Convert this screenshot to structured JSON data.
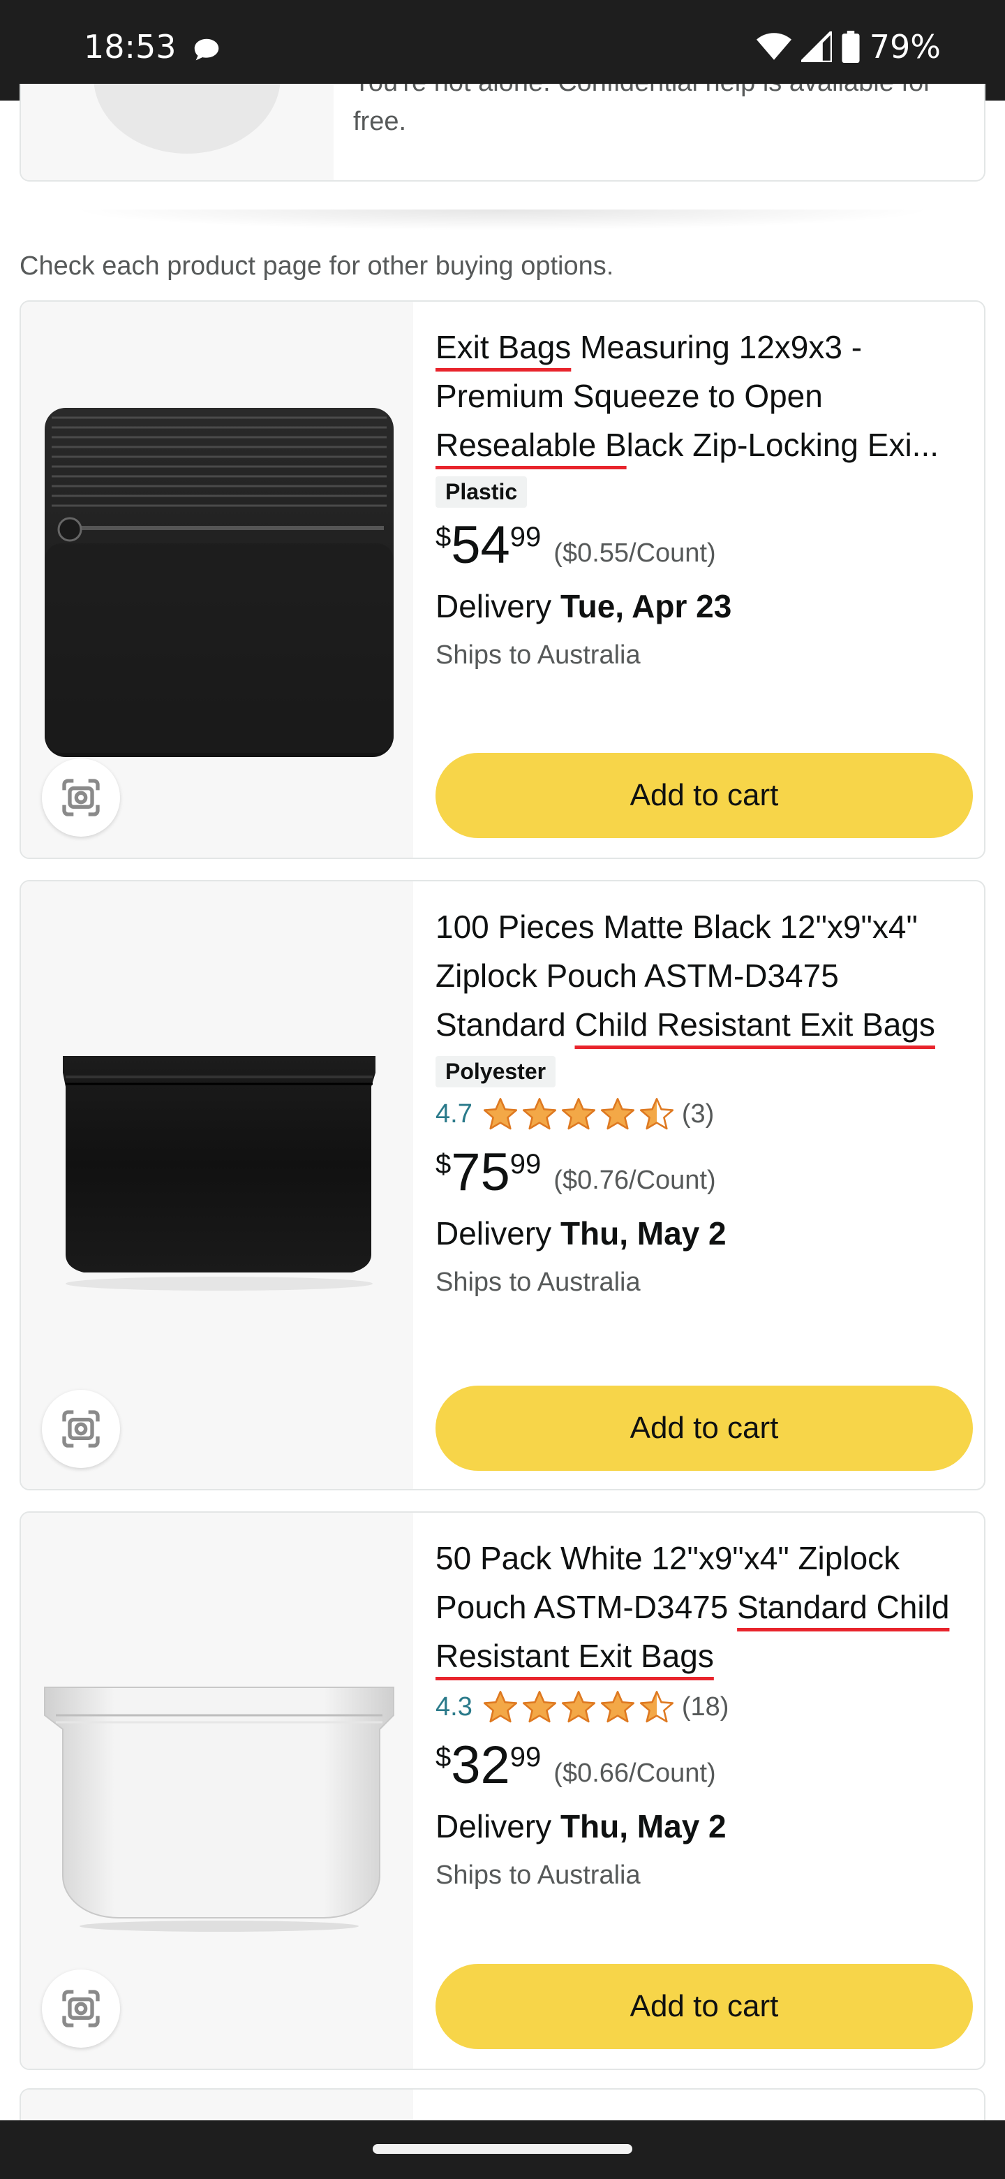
{
  "status_bar": {
    "time": "18:53",
    "battery": "79%"
  },
  "helpline": {
    "text": "You're not alone. Confidential help is available for free."
  },
  "options_note": "Check each product page for other buying options.",
  "colors": {
    "cart_button": "#f7d549",
    "rating": "#2a7a8a",
    "star": "#f3a847",
    "underline": "#e8242c"
  },
  "products": [
    {
      "title_parts": [
        "Exit Bags",
        " Measuring 12x9x3 - Premium Squeeze to Open ",
        "Resealable B",
        "lack Zip-Locking Exi..."
      ],
      "material": "Plastic",
      "price_currency": "$",
      "price_whole": "54",
      "price_fraction": "99",
      "unit_price": "($0.55/Count)",
      "delivery_label": "Delivery",
      "delivery_date": "Tue, Apr 23",
      "ships": "Ships to Australia",
      "cart_label": "Add to cart",
      "image": "black-zip-bag-stack"
    },
    {
      "title_parts": [
        "100 Pieces Matte Black 12\"x9\"x4\" Ziplock Pouch ASTM-D3475 Standard ",
        "Child Resistant Exit Bags"
      ],
      "material": "Polyester",
      "rating": "4.7",
      "stars": 4.5,
      "rating_count": "(3)",
      "price_currency": "$",
      "price_whole": "75",
      "price_fraction": "99",
      "unit_price": "($0.76/Count)",
      "delivery_label": "Delivery",
      "delivery_date": "Thu, May 2",
      "ships": "Ships to Australia",
      "cart_label": "Add to cart",
      "image": "matte-black-pouch"
    },
    {
      "title_parts": [
        "50 Pack White 12\"x9\"x4\" Ziplock Pouch ASTM-D3475 ",
        "Standard Child Resistant Exit Bags"
      ],
      "rating": "4.3",
      "stars": 4.5,
      "rating_count": "(18)",
      "price_currency": "$",
      "price_whole": "32",
      "price_fraction": "99",
      "unit_price": "($0.66/Count)",
      "delivery_label": "Delivery",
      "delivery_date": "Thu, May 2",
      "ships": "Ships to Australia",
      "cart_label": "Add to cart",
      "image": "white-pouch"
    }
  ]
}
